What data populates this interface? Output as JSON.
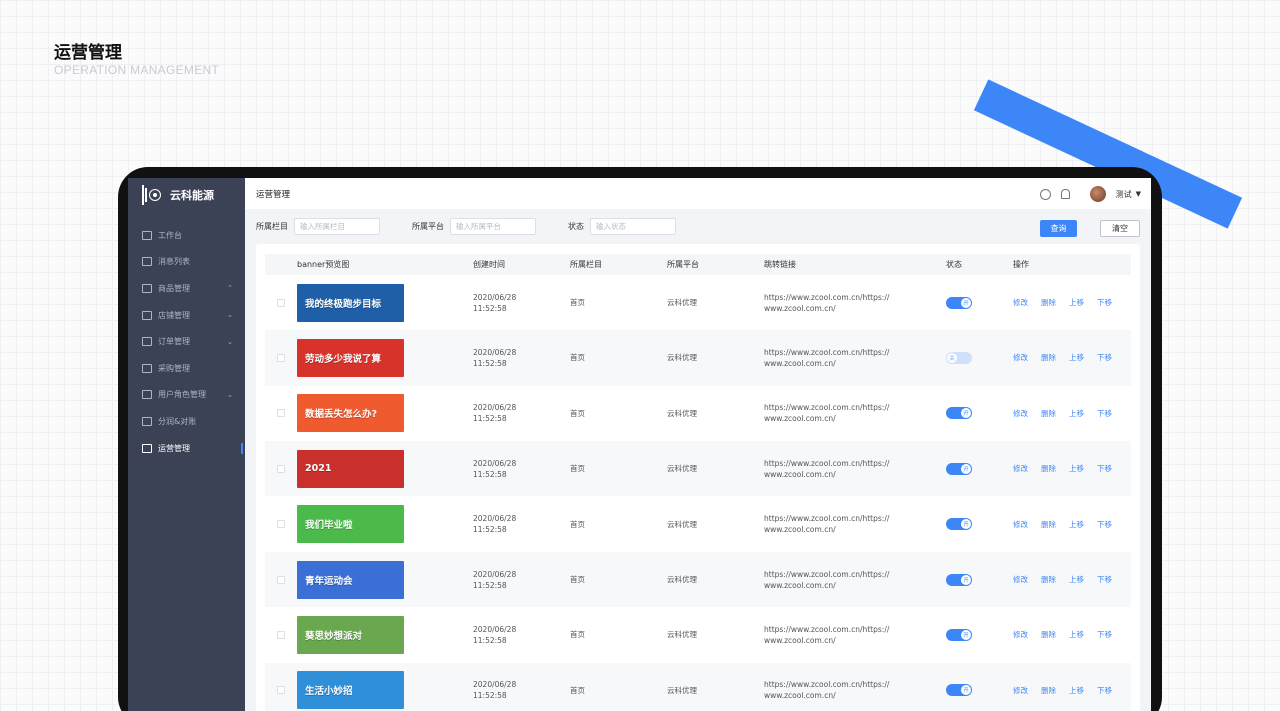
{
  "page": {
    "title": "运营管理",
    "subtitle": "OPERATION MANAGEMENT"
  },
  "app": {
    "logo_text": "云科能源",
    "header_title": "运营管理",
    "user_name": "测试"
  },
  "sidebar": {
    "items": [
      {
        "label": "工作台",
        "icon": "monitor-icon",
        "expandable": false,
        "active": false
      },
      {
        "label": "消息列表",
        "icon": "message-icon",
        "expandable": false,
        "active": false
      },
      {
        "label": "商品管理",
        "icon": "product-icon",
        "expandable": true,
        "chevron": "⌃",
        "active": false
      },
      {
        "label": "店铺管理",
        "icon": "store-icon",
        "expandable": true,
        "chevron": "⌄",
        "active": false
      },
      {
        "label": "订单管理",
        "icon": "order-icon",
        "expandable": true,
        "chevron": "⌄",
        "active": false
      },
      {
        "label": "采购管理",
        "icon": "purchase-icon",
        "expandable": false,
        "active": false
      },
      {
        "label": "用户角色管理",
        "icon": "user-icon",
        "expandable": true,
        "chevron": "⌄",
        "active": false
      },
      {
        "label": "分润&对账",
        "icon": "share-icon",
        "expandable": false,
        "active": false
      },
      {
        "label": "运营管理",
        "icon": "operation-icon",
        "expandable": false,
        "active": true
      }
    ]
  },
  "filters": {
    "column": {
      "label": "所属栏目",
      "placeholder": "输入所属栏目"
    },
    "platform": {
      "label": "所属平台",
      "placeholder": "输入所属平台"
    },
    "status": {
      "label": "状态",
      "placeholder": "输入状态"
    },
    "query_button": "查询",
    "clear_button": "清空"
  },
  "table": {
    "headers": {
      "preview": "banner预览图",
      "created": "创建时间",
      "column": "所属栏目",
      "platform": "所属平台",
      "link": "跳转链接",
      "status": "状态",
      "ops": "操作"
    },
    "ops_labels": {
      "edit": "修改",
      "delete": "删除",
      "up": "上移",
      "down": "下移"
    },
    "rows": [
      {
        "banner_text": "我的终极跑步目标",
        "banner_color": "#1e5fa8",
        "date": "2020/06/28",
        "time": "11:52:58",
        "column": "首页",
        "platform": "云科优理",
        "link1": "https://www.zcool.com.cn/https://",
        "link2": "www.zcool.com.cn/",
        "status_on": true,
        "status_text": "开"
      },
      {
        "banner_text": "劳动多少我说了算",
        "banner_color": "#d8332b",
        "date": "2020/06/28",
        "time": "11:52:58",
        "column": "首页",
        "platform": "云科优理",
        "link1": "https://www.zcool.com.cn/https://",
        "link2": "www.zcool.com.cn/",
        "status_on": false,
        "status_text": "关"
      },
      {
        "banner_text": "数据丢失怎么办?",
        "banner_color": "#ef5a2e",
        "date": "2020/06/28",
        "time": "11:52:58",
        "column": "首页",
        "platform": "云科优理",
        "link1": "https://www.zcool.com.cn/https://",
        "link2": "www.zcool.com.cn/",
        "status_on": true,
        "status_text": "开"
      },
      {
        "banner_text": "2021",
        "banner_color": "#c9302c",
        "date": "2020/06/28",
        "time": "11:52:58",
        "column": "首页",
        "platform": "云科优理",
        "link1": "https://www.zcool.com.cn/https://",
        "link2": "www.zcool.com.cn/",
        "status_on": true,
        "status_text": "开"
      },
      {
        "banner_text": "我们毕业啦",
        "banner_color": "#4cba4a",
        "date": "2020/06/28",
        "time": "11:52:58",
        "column": "首页",
        "platform": "云科优理",
        "link1": "https://www.zcool.com.cn/https://",
        "link2": "www.zcool.com.cn/",
        "status_on": true,
        "status_text": "开"
      },
      {
        "banner_text": "青年运动会",
        "banner_color": "#3a6fd6",
        "date": "2020/06/28",
        "time": "11:52:58",
        "column": "首页",
        "platform": "云科优理",
        "link1": "https://www.zcool.com.cn/https://",
        "link2": "www.zcool.com.cn/",
        "status_on": true,
        "status_text": "开"
      },
      {
        "banner_text": "葵思妙想派对",
        "banner_color": "#6aa84f",
        "date": "2020/06/28",
        "time": "11:52:58",
        "column": "首页",
        "platform": "云科优理",
        "link1": "https://www.zcool.com.cn/https://",
        "link2": "www.zcool.com.cn/",
        "status_on": true,
        "status_text": "开"
      },
      {
        "banner_text": "生活小妙招",
        "banner_color": "#2f8fd8",
        "date": "2020/06/28",
        "time": "11:52:58",
        "column": "首页",
        "platform": "云科优理",
        "link1": "https://www.zcool.com.cn/https://",
        "link2": "www.zcool.com.cn/",
        "status_on": true,
        "status_text": "开"
      }
    ]
  },
  "colors": {
    "accent": "#3d86f7",
    "sidebar_bg": "#3b4256",
    "decor_bar": "#3d86f7"
  }
}
